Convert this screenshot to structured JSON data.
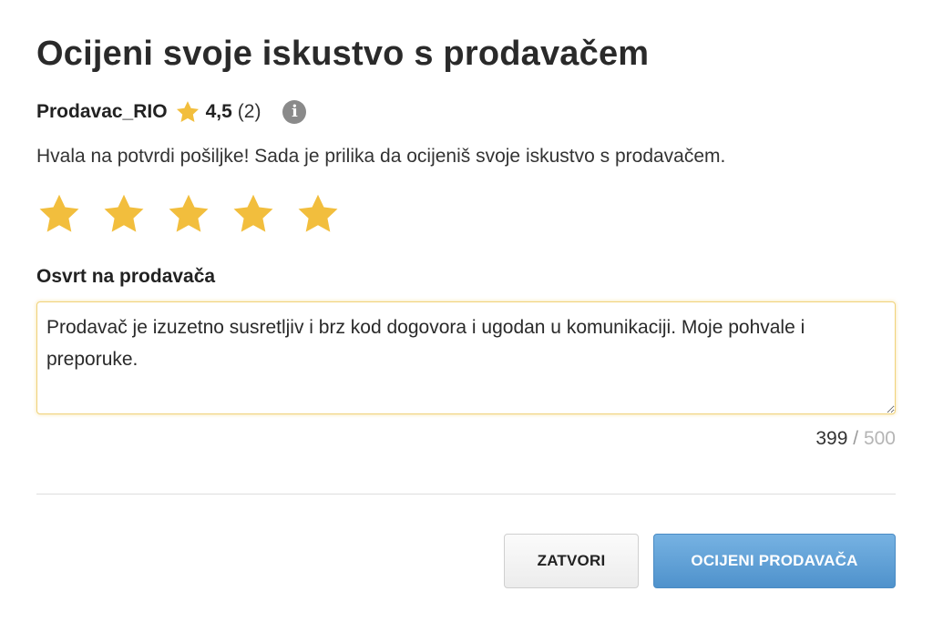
{
  "dialog": {
    "title": "Ocijeni svoje iskustvo s prodavačem"
  },
  "seller": {
    "name": "Prodavac_RIO",
    "rating": "4,5",
    "review_count": "(2)",
    "icons": {
      "star": "star-icon",
      "info": "info-icon"
    },
    "info_glyph": "i"
  },
  "thanks_text": "Hvala na potvrdi pošiljke! Sada je prilika da ocijeniš svoje iskustvo s prodavačem.",
  "rating_input": {
    "selected": 5,
    "max": 5,
    "star_color": "#f2be3d"
  },
  "review": {
    "label": "Osvrt na prodavača",
    "value": "Prodavač je izuzetno susretljiv i brz kod dogovora i ugodan u komunikaciji. Moje pohvale i preporuke.",
    "counter_current": "399",
    "counter_separator": "/",
    "counter_max": "500"
  },
  "buttons": {
    "close_label": "ZATVORI",
    "rate_label": "OCIJENI PRODAVAČA"
  },
  "colors": {
    "accent_blue": "#5b9fd6",
    "star_yellow": "#f2be3d",
    "text": "#222222"
  }
}
